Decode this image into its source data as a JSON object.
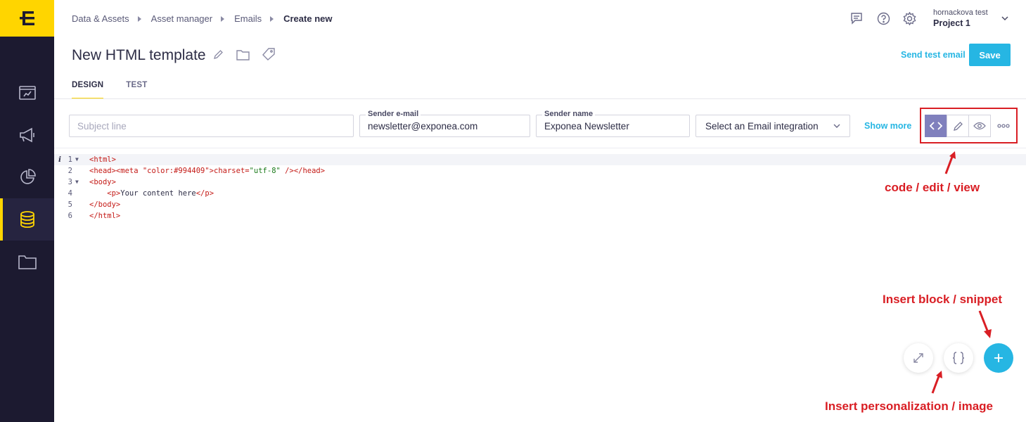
{
  "breadcrumb": {
    "items": [
      "Data & Assets",
      "Asset manager",
      "Emails"
    ],
    "current": "Create new"
  },
  "user": {
    "name": "hornackova test",
    "project": "Project 1"
  },
  "header": {
    "title": "New HTML template",
    "send_test_label": "Send test email",
    "save_label": "Save"
  },
  "tabs": [
    {
      "label": "DESIGN",
      "active": true
    },
    {
      "label": "TEST",
      "active": false
    }
  ],
  "form": {
    "subject": {
      "placeholder": "Subject line",
      "value": ""
    },
    "sender_email": {
      "label": "Sender e-mail",
      "value": "newsletter@exponea.com"
    },
    "sender_name": {
      "label": "Sender name",
      "value": "Exponea Newsletter"
    },
    "integration": {
      "selected": "Select an Email integration"
    },
    "show_more_label": "Show more"
  },
  "editor": {
    "lines": [
      {
        "num": "1",
        "text": "<html>",
        "fold": true,
        "info": true
      },
      {
        "num": "2",
        "text": "<head><meta charset=\"utf-8\" /></head>",
        "fold": false
      },
      {
        "num": "3",
        "text": "<body>",
        "fold": true
      },
      {
        "num": "4",
        "text": "    <p>Your content here</p>",
        "fold": false
      },
      {
        "num": "5",
        "text": "</body>",
        "fold": false
      },
      {
        "num": "6",
        "text": "</html>",
        "fold": false
      }
    ]
  },
  "annotations": {
    "modes": "code / edit / view",
    "insert_block": "Insert block / snippet",
    "insert_personalization": "Insert personalization / image"
  },
  "colors": {
    "accent": "#26b6e3",
    "brand_yellow": "#ffd500",
    "sidebar": "#1c1a30",
    "annotation_red": "#d91e24",
    "active_mode": "#8080bd"
  },
  "icons": {
    "sidebar": [
      "dashboard-icon",
      "megaphone-icon",
      "pie-chart-icon",
      "database-icon",
      "folder-icon"
    ],
    "top": [
      "chat-icon",
      "help-icon",
      "settings-icon",
      "chevron-down-icon"
    ],
    "modes": [
      "code-icon",
      "pencil-icon",
      "eye-icon",
      "more-icon"
    ],
    "fabs": [
      "expand-icon",
      "braces-icon",
      "plus-icon"
    ]
  }
}
